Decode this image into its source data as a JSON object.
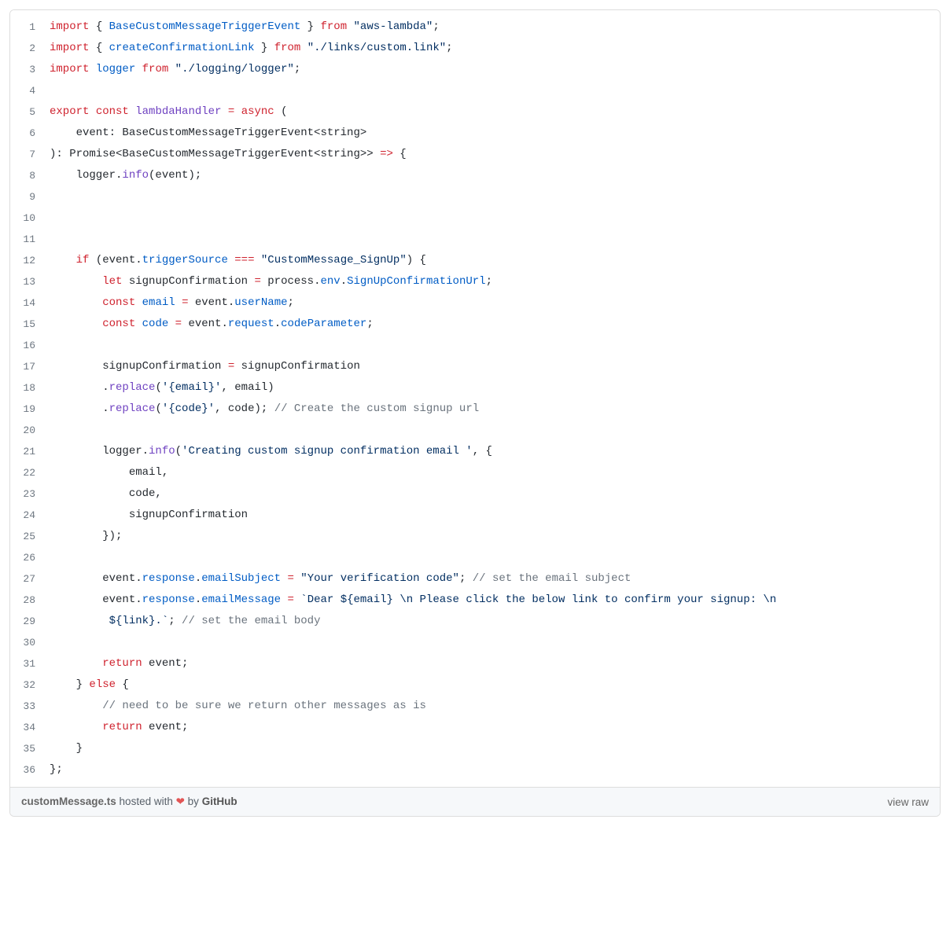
{
  "footer": {
    "filename": "customMessage.ts",
    "hosted_prefix": " hosted with ",
    "heart": "❤",
    "by": "by ",
    "github": "GitHub",
    "view_raw": "view raw"
  },
  "code": {
    "lines": [
      [
        {
          "c": "kw",
          "t": "import"
        },
        {
          "c": "plain",
          "t": " { "
        },
        {
          "c": "var",
          "t": "BaseCustomMessageTriggerEvent"
        },
        {
          "c": "plain",
          "t": " } "
        },
        {
          "c": "kw",
          "t": "from"
        },
        {
          "c": "plain",
          "t": " "
        },
        {
          "c": "str",
          "t": "\"aws-lambda\""
        },
        {
          "c": "plain",
          "t": ";"
        }
      ],
      [
        {
          "c": "kw",
          "t": "import"
        },
        {
          "c": "plain",
          "t": " { "
        },
        {
          "c": "var",
          "t": "createConfirmationLink"
        },
        {
          "c": "plain",
          "t": " } "
        },
        {
          "c": "kw",
          "t": "from"
        },
        {
          "c": "plain",
          "t": " "
        },
        {
          "c": "str",
          "t": "\"./links/custom.link\""
        },
        {
          "c": "plain",
          "t": ";"
        }
      ],
      [
        {
          "c": "kw",
          "t": "import"
        },
        {
          "c": "plain",
          "t": " "
        },
        {
          "c": "var",
          "t": "logger"
        },
        {
          "c": "plain",
          "t": " "
        },
        {
          "c": "kw",
          "t": "from"
        },
        {
          "c": "plain",
          "t": " "
        },
        {
          "c": "str",
          "t": "\"./logging/logger\""
        },
        {
          "c": "plain",
          "t": ";"
        }
      ],
      [],
      [
        {
          "c": "kw",
          "t": "export"
        },
        {
          "c": "plain",
          "t": " "
        },
        {
          "c": "kw",
          "t": "const"
        },
        {
          "c": "plain",
          "t": " "
        },
        {
          "c": "fn",
          "t": "lambdaHandler"
        },
        {
          "c": "plain",
          "t": " "
        },
        {
          "c": "op",
          "t": "="
        },
        {
          "c": "plain",
          "t": " "
        },
        {
          "c": "kw",
          "t": "async"
        },
        {
          "c": "plain",
          "t": " ("
        }
      ],
      [
        {
          "c": "plain",
          "t": "    event: BaseCustomMessageTriggerEvent<string>"
        }
      ],
      [
        {
          "c": "plain",
          "t": "): Promise<BaseCustomMessageTriggerEvent<string>> "
        },
        {
          "c": "op",
          "t": "=>"
        },
        {
          "c": "plain",
          "t": " {"
        }
      ],
      [
        {
          "c": "plain",
          "t": "    logger."
        },
        {
          "c": "fn",
          "t": "info"
        },
        {
          "c": "plain",
          "t": "(event);"
        }
      ],
      [],
      [],
      [],
      [
        {
          "c": "plain",
          "t": "    "
        },
        {
          "c": "kw",
          "t": "if"
        },
        {
          "c": "plain",
          "t": " (event."
        },
        {
          "c": "var",
          "t": "triggerSource"
        },
        {
          "c": "plain",
          "t": " "
        },
        {
          "c": "op",
          "t": "==="
        },
        {
          "c": "plain",
          "t": " "
        },
        {
          "c": "str",
          "t": "\"CustomMessage_SignUp\""
        },
        {
          "c": "plain",
          "t": ") {"
        }
      ],
      [
        {
          "c": "plain",
          "t": "        "
        },
        {
          "c": "kw",
          "t": "let"
        },
        {
          "c": "plain",
          "t": " signupConfirmation "
        },
        {
          "c": "op",
          "t": "="
        },
        {
          "c": "plain",
          "t": " process."
        },
        {
          "c": "var",
          "t": "env"
        },
        {
          "c": "plain",
          "t": "."
        },
        {
          "c": "var",
          "t": "SignUpConfirmationUrl"
        },
        {
          "c": "plain",
          "t": ";"
        }
      ],
      [
        {
          "c": "plain",
          "t": "        "
        },
        {
          "c": "kw",
          "t": "const"
        },
        {
          "c": "plain",
          "t": " "
        },
        {
          "c": "var",
          "t": "email"
        },
        {
          "c": "plain",
          "t": " "
        },
        {
          "c": "op",
          "t": "="
        },
        {
          "c": "plain",
          "t": " event."
        },
        {
          "c": "var",
          "t": "userName"
        },
        {
          "c": "plain",
          "t": ";"
        }
      ],
      [
        {
          "c": "plain",
          "t": "        "
        },
        {
          "c": "kw",
          "t": "const"
        },
        {
          "c": "plain",
          "t": " "
        },
        {
          "c": "var",
          "t": "code"
        },
        {
          "c": "plain",
          "t": " "
        },
        {
          "c": "op",
          "t": "="
        },
        {
          "c": "plain",
          "t": " event."
        },
        {
          "c": "var",
          "t": "request"
        },
        {
          "c": "plain",
          "t": "."
        },
        {
          "c": "var",
          "t": "codeParameter"
        },
        {
          "c": "plain",
          "t": ";"
        }
      ],
      [],
      [
        {
          "c": "plain",
          "t": "        signupConfirmation "
        },
        {
          "c": "op",
          "t": "="
        },
        {
          "c": "plain",
          "t": " signupConfirmation"
        }
      ],
      [
        {
          "c": "plain",
          "t": "        ."
        },
        {
          "c": "fn",
          "t": "replace"
        },
        {
          "c": "plain",
          "t": "("
        },
        {
          "c": "str",
          "t": "'{email}'"
        },
        {
          "c": "plain",
          "t": ", email)"
        }
      ],
      [
        {
          "c": "plain",
          "t": "        ."
        },
        {
          "c": "fn",
          "t": "replace"
        },
        {
          "c": "plain",
          "t": "("
        },
        {
          "c": "str",
          "t": "'{code}'"
        },
        {
          "c": "plain",
          "t": ", code); "
        },
        {
          "c": "cmt",
          "t": "// Create the custom signup url"
        }
      ],
      [],
      [
        {
          "c": "plain",
          "t": "        logger."
        },
        {
          "c": "fn",
          "t": "info"
        },
        {
          "c": "plain",
          "t": "("
        },
        {
          "c": "str",
          "t": "'Creating custom signup confirmation email '"
        },
        {
          "c": "plain",
          "t": ", {"
        }
      ],
      [
        {
          "c": "plain",
          "t": "            email,"
        }
      ],
      [
        {
          "c": "plain",
          "t": "            code,"
        }
      ],
      [
        {
          "c": "plain",
          "t": "            signupConfirmation"
        }
      ],
      [
        {
          "c": "plain",
          "t": "        });"
        }
      ],
      [],
      [
        {
          "c": "plain",
          "t": "        event."
        },
        {
          "c": "var",
          "t": "response"
        },
        {
          "c": "plain",
          "t": "."
        },
        {
          "c": "var",
          "t": "emailSubject"
        },
        {
          "c": "plain",
          "t": " "
        },
        {
          "c": "op",
          "t": "="
        },
        {
          "c": "plain",
          "t": " "
        },
        {
          "c": "str",
          "t": "\"Your verification code\""
        },
        {
          "c": "plain",
          "t": "; "
        },
        {
          "c": "cmt",
          "t": "// set the email subject"
        }
      ],
      [
        {
          "c": "plain",
          "t": "        event."
        },
        {
          "c": "var",
          "t": "response"
        },
        {
          "c": "plain",
          "t": "."
        },
        {
          "c": "var",
          "t": "emailMessage"
        },
        {
          "c": "plain",
          "t": " "
        },
        {
          "c": "op",
          "t": "="
        },
        {
          "c": "plain",
          "t": " "
        },
        {
          "c": "str",
          "t": "`Dear ${email} \\n Please click the below link to confirm your signup: \\n"
        }
      ],
      [
        {
          "c": "str",
          "t": "         ${link}.`"
        },
        {
          "c": "plain",
          "t": "; "
        },
        {
          "c": "cmt",
          "t": "// set the email body"
        }
      ],
      [],
      [
        {
          "c": "plain",
          "t": "        "
        },
        {
          "c": "kw",
          "t": "return"
        },
        {
          "c": "plain",
          "t": " event;"
        }
      ],
      [
        {
          "c": "plain",
          "t": "    } "
        },
        {
          "c": "kw",
          "t": "else"
        },
        {
          "c": "plain",
          "t": " {"
        }
      ],
      [
        {
          "c": "plain",
          "t": "        "
        },
        {
          "c": "cmt",
          "t": "// need to be sure we return other messages as is"
        }
      ],
      [
        {
          "c": "plain",
          "t": "        "
        },
        {
          "c": "kw",
          "t": "return"
        },
        {
          "c": "plain",
          "t": " event;"
        }
      ],
      [
        {
          "c": "plain",
          "t": "    }"
        }
      ],
      [
        {
          "c": "plain",
          "t": "};"
        }
      ]
    ]
  }
}
